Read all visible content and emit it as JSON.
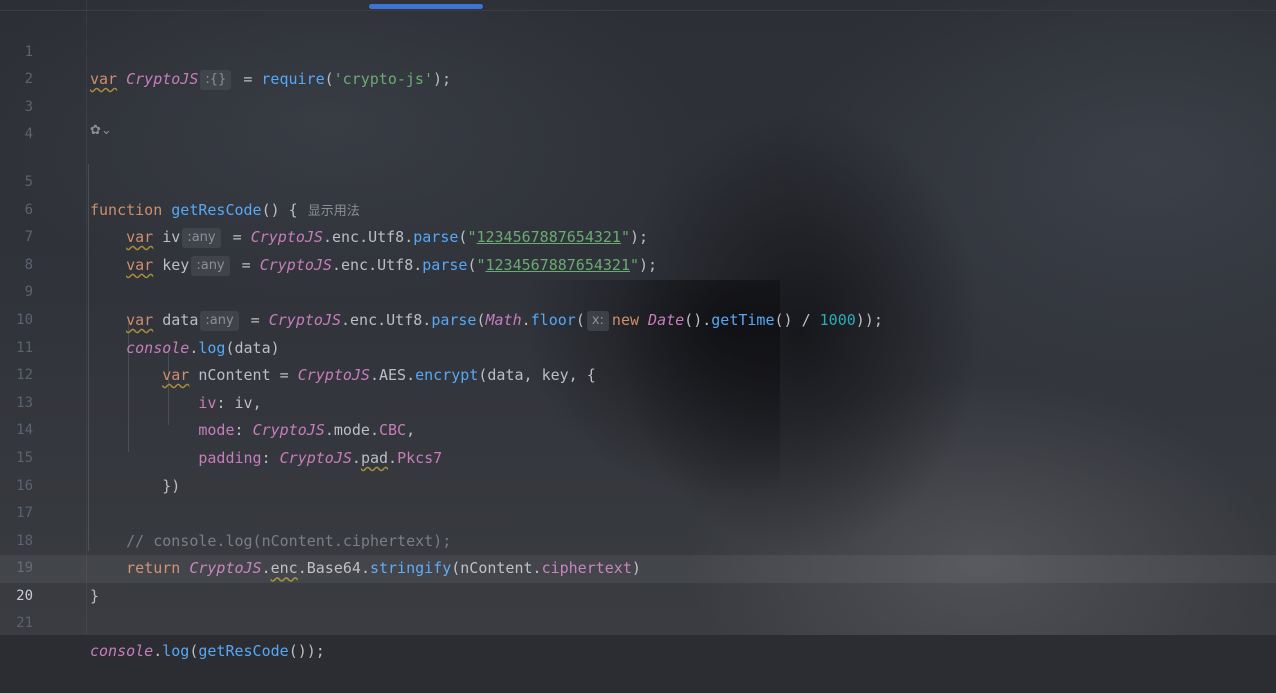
{
  "editor": {
    "line_numbers": [
      "1",
      "2",
      "3",
      "4",
      "5",
      "6",
      "7",
      "8",
      "9",
      "10",
      "11",
      "12",
      "13",
      "14",
      "15",
      "16",
      "17",
      "18",
      "19",
      "20",
      "21"
    ],
    "current_line": "20",
    "hints": {
      "cryptojs_type": ":{}",
      "iv_type": ":any",
      "key_type": ":any",
      "data_type": ":any",
      "floor_param": "x:",
      "usage_hint": "显示用法"
    },
    "tokens": {
      "var": "var",
      "function": "function",
      "return": "return",
      "new": "new",
      "CryptoJS": "CryptoJS",
      "require": "require",
      "crypto_js_str": "'crypto-js'",
      "getResCode": "getResCode",
      "iv": "iv",
      "key": "key",
      "data": "data",
      "enc": "enc",
      "Utf8": "Utf8",
      "parse": "parse",
      "str_value": "1234567887654321",
      "Math": "Math",
      "floor": "floor",
      "Date": "Date",
      "getTime": "getTime",
      "num_1000": "1000",
      "console": "console",
      "log": "log",
      "nContent": "nContent",
      "AES": "AES",
      "encrypt": "encrypt",
      "mode_key": "mode",
      "padding_key": "padding",
      "mode": "mode",
      "CBC": "CBC",
      "pad": "pad",
      "Pkcs7": "Pkcs7",
      "comment17": "// console.log(nContent.ciphertext);",
      "Base64": "Base64",
      "stringify": "stringify",
      "ciphertext": "ciphertext"
    }
  }
}
